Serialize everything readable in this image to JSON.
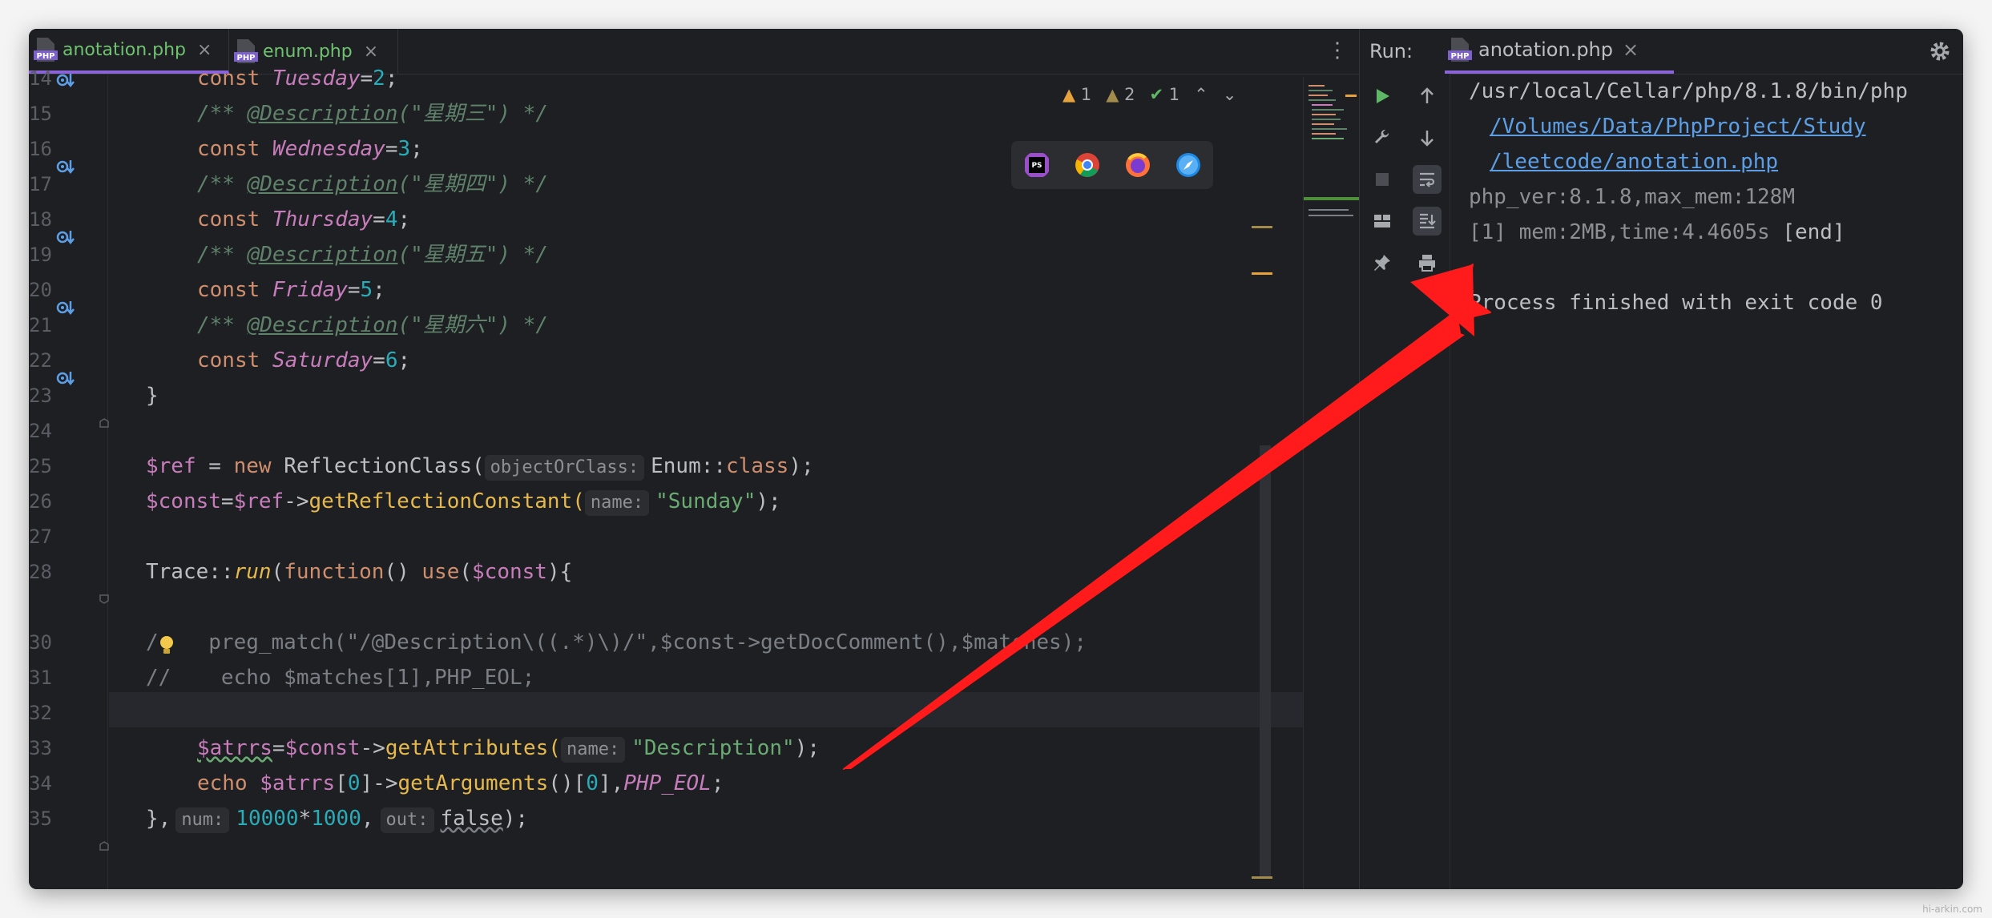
{
  "editor": {
    "tabs": [
      {
        "label": "anotation.php",
        "icon": "php-file-icon",
        "active": true
      },
      {
        "label": "enum.php",
        "icon": "php-file-icon",
        "active": false
      }
    ],
    "inspections": {
      "warnings": "1",
      "weak_warnings": "2",
      "typos": "1"
    },
    "browsers": [
      "phpstorm-icon",
      "chrome-icon",
      "firefox-icon",
      "safari-icon"
    ],
    "line_numbers": [
      "14",
      "15",
      "16",
      "17",
      "18",
      "19",
      "20",
      "21",
      "22",
      "23",
      "24",
      "25",
      "26",
      "27",
      "28",
      "30",
      "31",
      "32",
      "33",
      "34",
      "35"
    ],
    "code": {
      "l14": {
        "kw": "const ",
        "name": "Tuesday",
        "eq": "=",
        "val": "2",
        "semi": ";"
      },
      "l15": {
        "open": "/** ",
        "tag": "@Description",
        "rest": "(\"星期三\") */"
      },
      "l16": {
        "kw": "const ",
        "name": "Wednesday",
        "eq": "=",
        "val": "3",
        "semi": ";"
      },
      "l17": {
        "open": "/** ",
        "tag": "@Description",
        "rest": "(\"星期四\") */"
      },
      "l18": {
        "kw": "const ",
        "name": "Thursday",
        "eq": "=",
        "val": "4",
        "semi": ";"
      },
      "l19": {
        "open": "/** ",
        "tag": "@Description",
        "rest": "(\"星期五\") */"
      },
      "l20": {
        "kw": "const ",
        "name": "Friday",
        "eq": "=",
        "val": "5",
        "semi": ";"
      },
      "l21": {
        "open": "/** ",
        "tag": "@Description",
        "rest": "(\"星期六\") */"
      },
      "l22": {
        "kw": "const ",
        "name": "Saturday",
        "eq": "=",
        "val": "6",
        "semi": ";"
      },
      "l23": {
        "text": "}"
      },
      "l25": {
        "var": "$ref",
        "eq": " = ",
        "kw": "new ",
        "cls": "ReflectionClass(",
        "hint": "objectOrClass:",
        "arg": "Enum::",
        "kw2": "class",
        "end": ");"
      },
      "l26": {
        "var": "$const",
        "eq": "=",
        "var2": "$ref",
        "arrow": "->",
        "fn": "getReflectionConstant(",
        "hint": "name:",
        "str": "\"Sunday\"",
        "end": ");"
      },
      "l28": {
        "cls": "Trace::",
        "fn": "run",
        "p1": "(",
        "kw": "function",
        "p2": "() ",
        "kw2": "use",
        "p3": "(",
        "var": "$const",
        "p4": "){"
      },
      "l30": {
        "text": "/    preg_match(\"/@Description\\((.*)\\)/\",$const->getDocComment(),$matches);"
      },
      "l31": {
        "text": "//    echo $matches[1],PHP_EOL;"
      },
      "l33": {
        "var": "$atrrs",
        "eq": "=",
        "var2": "$const",
        "arrow": "->",
        "fn": "getAttributes(",
        "hint": "name:",
        "str": "\"Description\"",
        "end": ");"
      },
      "l34": {
        "kw": "echo ",
        "var": "$atrrs",
        "b1": "[",
        "n1": "0",
        "b2": "]->",
        "fn": "getArguments",
        "p": "()[",
        "n2": "0",
        "b3": "],",
        "cn": "PHP_EOL",
        "end": ";"
      },
      "l35": {
        "start": "},",
        "hint1": "num:",
        "n1": "10000",
        "op": "*",
        "n2": "1000",
        "comma": ",",
        "hint2": "out:",
        "kw": "false",
        "end": ");"
      }
    }
  },
  "run": {
    "label": "Run:",
    "tab": "anotation.php",
    "console": [
      {
        "text": "/usr/local/Cellar/php/8.1.8/bin/php",
        "style": "normal"
      },
      {
        "text": "/Volumes/Data/PhpProject/Study",
        "style": "link"
      },
      {
        "text": "/leetcode/anotation.php",
        "style": "link"
      },
      {
        "text": "php_ver:8.1.8,max_mem:128M",
        "style": "gray"
      },
      {
        "text": "[1] mem:2MB,time:4.4605s",
        "style": "gray",
        "suffix": " [end]"
      },
      {
        "text": "",
        "style": "normal"
      },
      {
        "text": "Process finished with exit code 0",
        "style": "normal"
      }
    ]
  },
  "watermark": "hi-arkin.com",
  "colors": {
    "accent": "#8a64d8",
    "annotation_arrow": "#ff1b1b",
    "run_green": "#5fb865"
  }
}
